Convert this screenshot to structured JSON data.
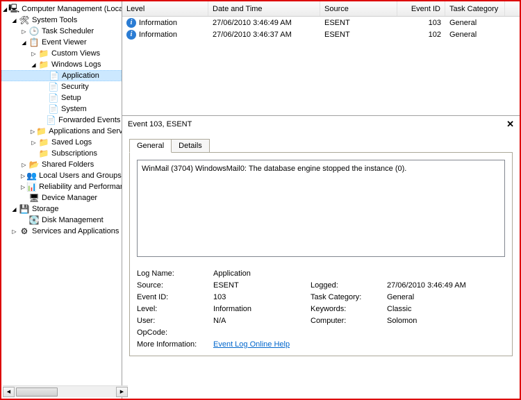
{
  "tree": {
    "root": "Computer Management (Local)",
    "systools": "System Tools",
    "tasksched": "Task Scheduler",
    "eventviewer": "Event Viewer",
    "customviews": "Custom Views",
    "winlogs": "Windows Logs",
    "application": "Application",
    "security": "Security",
    "setup": "Setup",
    "system": "System",
    "forwarded": "Forwarded Events",
    "appservices": "Applications and Services Logs",
    "savedlogs": "Saved Logs",
    "subscriptions": "Subscriptions",
    "sharedfolders": "Shared Folders",
    "localusers": "Local Users and Groups",
    "reliability": "Reliability and Performance",
    "devmgr": "Device Manager",
    "storage": "Storage",
    "diskmgmt": "Disk Management",
    "services": "Services and Applications"
  },
  "grid": {
    "cols": {
      "level": "Level",
      "date": "Date and Time",
      "source": "Source",
      "id": "Event ID",
      "cat": "Task Category"
    },
    "rows": [
      {
        "level": "Information",
        "date": "27/06/2010 3:46:49 AM",
        "source": "ESENT",
        "id": "103",
        "cat": "General"
      },
      {
        "level": "Information",
        "date": "27/06/2010 3:46:37 AM",
        "source": "ESENT",
        "id": "102",
        "cat": "General"
      }
    ]
  },
  "detail": {
    "title": "Event 103, ESENT",
    "tabs": {
      "general": "General",
      "details": "Details"
    },
    "message": "WinMail (3704) WindowsMail0: The database engine stopped the instance (0).",
    "labels": {
      "logname": "Log Name:",
      "source": "Source:",
      "eventid": "Event ID:",
      "level": "Level:",
      "user": "User:",
      "opcode": "OpCode:",
      "moreinfo": "More Information:",
      "logged": "Logged:",
      "taskcat": "Task Category:",
      "keywords": "Keywords:",
      "computer": "Computer:"
    },
    "values": {
      "logname": "Application",
      "source": "ESENT",
      "eventid": "103",
      "level": "Information",
      "user": "N/A",
      "opcode": "",
      "logged": "27/06/2010 3:46:49 AM",
      "taskcat": "General",
      "keywords": "Classic",
      "computer": "Solomon",
      "helpLink": "Event Log Online Help"
    }
  }
}
